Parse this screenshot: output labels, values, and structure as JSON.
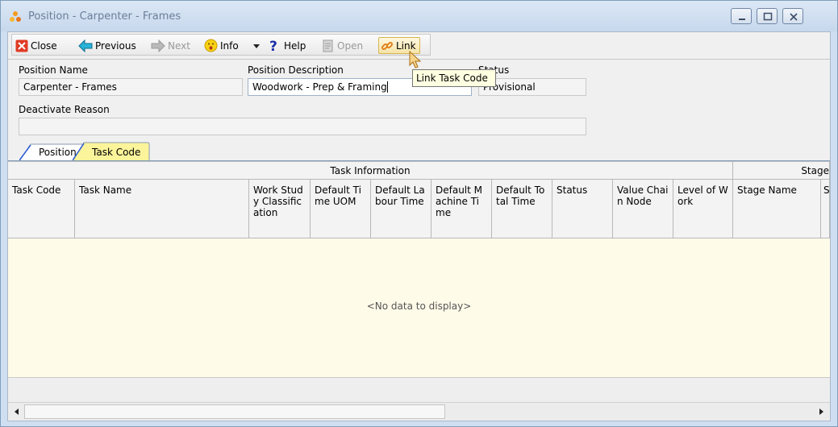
{
  "window": {
    "title": "Position - Carpenter - Frames"
  },
  "toolbar": {
    "close": "Close",
    "previous": "Previous",
    "next": "Next",
    "info": "Info",
    "help": "Help",
    "open": "Open",
    "link": "Link"
  },
  "tooltip": "Link Task Code",
  "form": {
    "position_name_label": "Position Name",
    "position_name_value": "Carpenter - Frames",
    "position_description_label": "Position Description",
    "position_description_value": "Woodwork - Prep & Framing",
    "status_label": "Status",
    "status_value": "Provisional",
    "deactivate_reason_label": "Deactivate Reason",
    "deactivate_reason_value": ""
  },
  "tabs": [
    "Position",
    "Task Code"
  ],
  "grid": {
    "band_task_information": "Task Information",
    "band_stage": "Stage",
    "columns": [
      "Task Code",
      "Task Name",
      "Work Study Classification",
      "Default Time UOM",
      "Default Labour Time",
      "Default Machine Time",
      "Default Total Time",
      "Status",
      "Value Chain Node",
      "Level of Work",
      "Stage Name",
      "S"
    ],
    "empty_text": "<No data to display>"
  },
  "colors": {
    "active_tab": "#fbf49a",
    "tooltip_bg": "#ffffe1",
    "grid_bg": "#fffbe9"
  }
}
